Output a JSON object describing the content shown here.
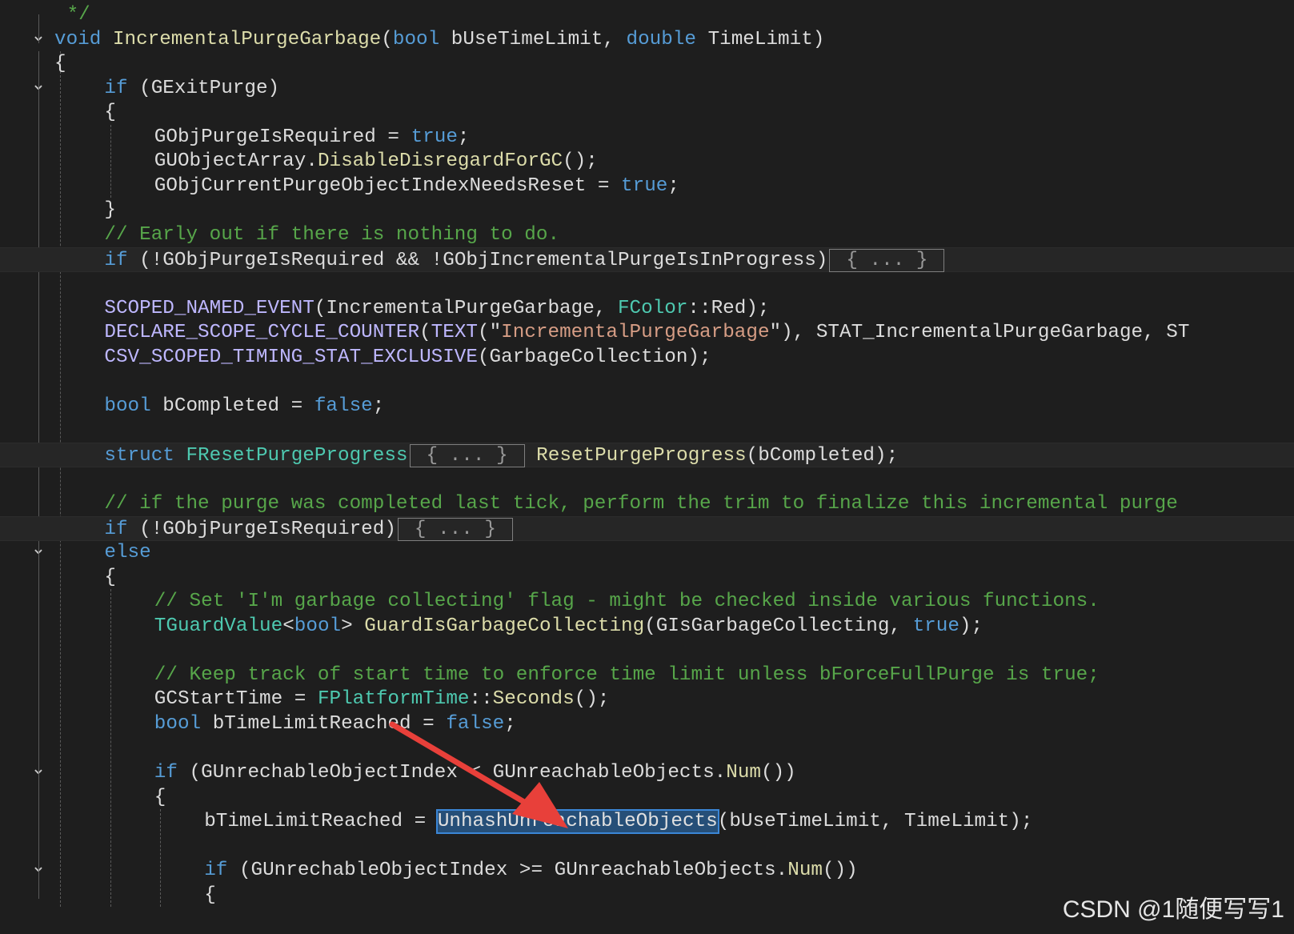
{
  "editor": {
    "lines": [
      {
        "segments": [
          {
            "t": "*/",
            "c": "cm"
          }
        ]
      },
      {
        "segments": [
          {
            "t": "void ",
            "c": "kw"
          },
          {
            "t": "IncrementalPurgeGarbage",
            "c": "fn"
          },
          {
            "t": "(",
            "c": "pl"
          },
          {
            "t": "bool ",
            "c": "kw"
          },
          {
            "t": "bUseTimeLimit, ",
            "c": "pl"
          },
          {
            "t": "double ",
            "c": "kw"
          },
          {
            "t": "TimeLimit)",
            "c": "pl"
          }
        ]
      },
      {
        "segments": [
          {
            "t": "{",
            "c": "pl"
          }
        ]
      },
      {
        "segments": [
          {
            "t": "if ",
            "c": "kw"
          },
          {
            "t": "(GExitPurge)",
            "c": "pl"
          }
        ]
      },
      {
        "segments": [
          {
            "t": "{",
            "c": "pl"
          }
        ]
      },
      {
        "segments": [
          {
            "t": "GObjPurgeIsRequired = ",
            "c": "pl"
          },
          {
            "t": "true",
            "c": "kw"
          },
          {
            "t": ";",
            "c": "pl"
          }
        ]
      },
      {
        "segments": [
          {
            "t": "GUObjectArray.",
            "c": "pl"
          },
          {
            "t": "DisableDisregardForGC",
            "c": "fn"
          },
          {
            "t": "();",
            "c": "pl"
          }
        ]
      },
      {
        "segments": [
          {
            "t": "GObjCurrentPurgeObjectIndexNeedsReset = ",
            "c": "pl"
          },
          {
            "t": "true",
            "c": "kw"
          },
          {
            "t": ";",
            "c": "pl"
          }
        ]
      },
      {
        "segments": [
          {
            "t": "}",
            "c": "pl"
          }
        ]
      },
      {
        "segments": [
          {
            "t": "// Early out if there is nothing to do.",
            "c": "cm"
          }
        ]
      },
      {
        "segments": [
          {
            "t": "if ",
            "c": "kw"
          },
          {
            "t": "(!GObjPurgeIsRequired && !GObjIncrementalPurgeIsInProgress)",
            "c": "pl"
          }
        ],
        "collapsed": "{ ... }"
      },
      {
        "segments": []
      },
      {
        "segments": [
          {
            "t": "SCOPED_NAMED_EVENT",
            "c": "mac"
          },
          {
            "t": "(IncrementalPurgeGarbage, ",
            "c": "pl"
          },
          {
            "t": "FColor",
            "c": "ty"
          },
          {
            "t": "::Red);",
            "c": "pl"
          }
        ]
      },
      {
        "segments": [
          {
            "t": "DECLARE_SCOPE_CYCLE_COUNTER",
            "c": "mac"
          },
          {
            "t": "(",
            "c": "pl"
          },
          {
            "t": "TEXT",
            "c": "mac"
          },
          {
            "t": "(\"",
            "c": "pl"
          },
          {
            "t": "IncrementalPurgeGarbage",
            "c": "str"
          },
          {
            "t": "\"), STAT_IncrementalPurgeGarbage, ST",
            "c": "pl"
          }
        ]
      },
      {
        "segments": [
          {
            "t": "CSV_SCOPED_TIMING_STAT_EXCLUSIVE",
            "c": "mac"
          },
          {
            "t": "(GarbageCollection);",
            "c": "pl"
          }
        ]
      },
      {
        "segments": []
      },
      {
        "segments": [
          {
            "t": "bool ",
            "c": "kw"
          },
          {
            "t": "bCompleted = ",
            "c": "pl"
          },
          {
            "t": "false",
            "c": "kw"
          },
          {
            "t": ";",
            "c": "pl"
          }
        ]
      },
      {
        "segments": []
      },
      {
        "segments": [
          {
            "t": "struct ",
            "c": "kw"
          },
          {
            "t": "FResetPurgeProgress",
            "c": "ty"
          }
        ],
        "collapsed": "{ ... }",
        "after": [
          {
            "t": " ",
            "c": "pl"
          },
          {
            "t": "ResetPurgeProgress",
            "c": "fn"
          },
          {
            "t": "(bCompleted);",
            "c": "pl"
          }
        ]
      },
      {
        "segments": []
      },
      {
        "segments": [
          {
            "t": "// if the purge was completed last tick, perform the trim to finalize this incremental purge",
            "c": "cm"
          }
        ]
      },
      {
        "segments": [
          {
            "t": "if ",
            "c": "kw"
          },
          {
            "t": "(!GObjPurgeIsRequired)",
            "c": "pl"
          }
        ],
        "collapsed": "{ ... }"
      },
      {
        "segments": [
          {
            "t": "else",
            "c": "kw"
          }
        ]
      },
      {
        "segments": [
          {
            "t": "{",
            "c": "pl"
          }
        ]
      },
      {
        "segments": [
          {
            "t": "// Set 'I'm garbage collecting' flag - might be checked inside various functions.",
            "c": "cm"
          }
        ]
      },
      {
        "segments": [
          {
            "t": "TGuardValue",
            "c": "ty"
          },
          {
            "t": "<",
            "c": "pl"
          },
          {
            "t": "bool",
            "c": "kw"
          },
          {
            "t": "> ",
            "c": "pl"
          },
          {
            "t": "GuardIsGarbageCollecting",
            "c": "fn"
          },
          {
            "t": "(GIsGarbageCollecting, ",
            "c": "pl"
          },
          {
            "t": "true",
            "c": "kw"
          },
          {
            "t": ");",
            "c": "pl"
          }
        ]
      },
      {
        "segments": []
      },
      {
        "segments": [
          {
            "t": "// Keep track of start time to enforce time limit unless bForceFullPurge is true;",
            "c": "cm"
          }
        ]
      },
      {
        "segments": [
          {
            "t": "GCStartTime = ",
            "c": "pl"
          },
          {
            "t": "FPlatformTime",
            "c": "ty"
          },
          {
            "t": "::",
            "c": "pl"
          },
          {
            "t": "Seconds",
            "c": "fn"
          },
          {
            "t": "();",
            "c": "pl"
          }
        ]
      },
      {
        "segments": [
          {
            "t": "bool ",
            "c": "kw"
          },
          {
            "t": "bTimeLimitReached = ",
            "c": "pl"
          },
          {
            "t": "false",
            "c": "kw"
          },
          {
            "t": ";",
            "c": "pl"
          }
        ]
      },
      {
        "segments": []
      },
      {
        "segments": [
          {
            "t": "if ",
            "c": "kw"
          },
          {
            "t": "(GUnrechableObjectIndex < GUnreachableObjects.",
            "c": "pl"
          },
          {
            "t": "Num",
            "c": "fn"
          },
          {
            "t": "())",
            "c": "pl"
          }
        ]
      },
      {
        "segments": [
          {
            "t": "{",
            "c": "pl"
          }
        ]
      },
      {
        "segments": [
          {
            "t": "bTimeLimitReached = ",
            "c": "pl"
          },
          {
            "t": "UnhashUnreachableObjects",
            "c": "fn",
            "sel": true
          },
          {
            "t": "(bUseTimeLimit, TimeLimit);",
            "c": "pl"
          }
        ]
      },
      {
        "segments": []
      },
      {
        "segments": [
          {
            "t": "if ",
            "c": "kw"
          },
          {
            "t": "(GUnrechableObjectIndex >= GUnreachableObjects.",
            "c": "pl"
          },
          {
            "t": "Num",
            "c": "fn"
          },
          {
            "t": "())",
            "c": "pl"
          }
        ]
      },
      {
        "segments": [
          {
            "t": "{",
            "c": "pl"
          }
        ]
      }
    ]
  },
  "icons": {
    "fold_expanded": "chevron-down-icon",
    "fold_collapsed": "chevron-right-icon"
  },
  "annotation": {
    "arrow_color": "#e8403a"
  },
  "watermark": {
    "text": "CSDN @1随便写写1"
  }
}
